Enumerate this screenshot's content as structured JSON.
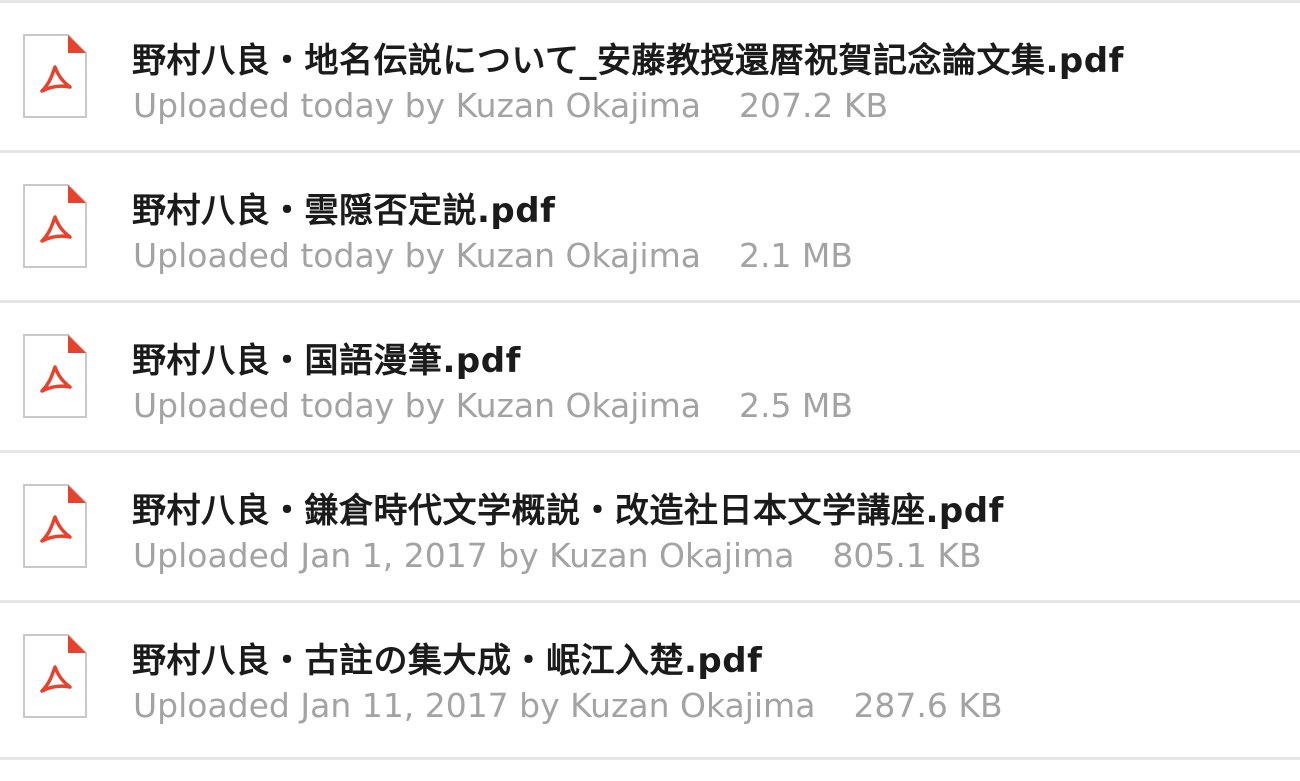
{
  "files": [
    {
      "name": "野村八良・地名伝説について_安藤教授還暦祝賀記念論文集.pdf",
      "meta": "Uploaded today by Kuzan Okajima",
      "size": "207.2 KB",
      "icon": "pdf-file-icon"
    },
    {
      "name": "野村八良・雲隠否定説.pdf",
      "meta": "Uploaded today by Kuzan Okajima",
      "size": "2.1 MB",
      "icon": "pdf-file-icon"
    },
    {
      "name": "野村八良・国語漫筆.pdf",
      "meta": "Uploaded today by Kuzan Okajima",
      "size": "2.5 MB",
      "icon": "pdf-file-icon"
    },
    {
      "name": "野村八良・鎌倉時代文学概説・改造社日本文学講座.pdf",
      "meta": "Uploaded Jan 1, 2017 by Kuzan Okajima",
      "size": "805.1 KB",
      "icon": "pdf-file-icon"
    },
    {
      "name": "野村八良・古註の集大成・岷江入楚.pdf",
      "meta": "Uploaded Jan 11, 2017 by Kuzan Okajima",
      "size": "287.6 KB",
      "icon": "pdf-file-icon"
    }
  ],
  "colors": {
    "pdf_accent": "#e8412c",
    "divider": "#e6e6e6",
    "name_text": "#1b1b1b",
    "meta_text": "#a3a3a3"
  }
}
